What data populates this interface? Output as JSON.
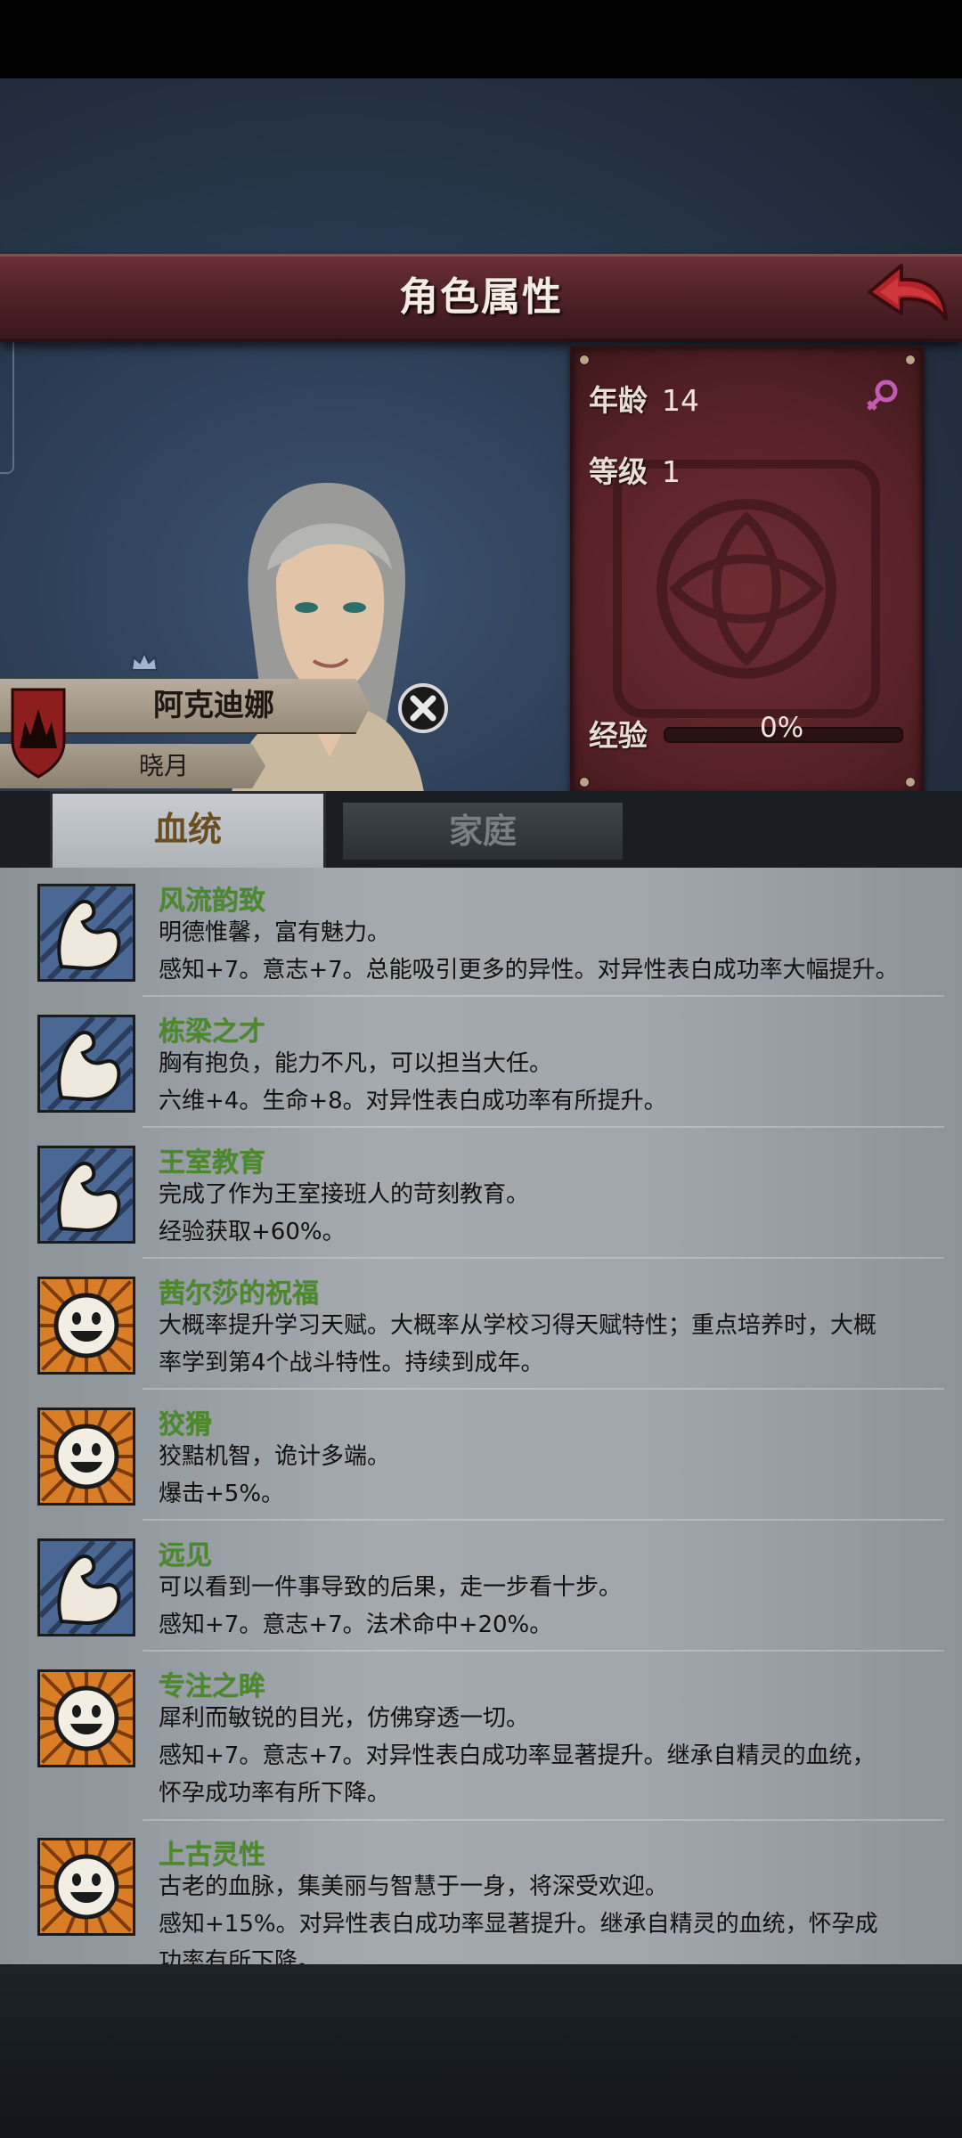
{
  "header": {
    "title": "角色属性"
  },
  "stats": {
    "age_label": "年龄",
    "age_value": "14",
    "level_label": "等级",
    "level_value": "1",
    "exp_label": "经验",
    "exp_value": "0%",
    "exp_fraction": 0
  },
  "character": {
    "name": "阿克迪娜",
    "house": "晓月"
  },
  "tabs": [
    {
      "label": "血统"
    },
    {
      "label": "家庭"
    }
  ],
  "traits": [
    {
      "name": "风流韵致",
      "icon": "muscle-icon",
      "lines": [
        "明德惟馨，富有魅力。",
        "感知+7。意志+7。总能吸引更多的异性。对异性表白成功率大幅提升。"
      ]
    },
    {
      "name": "栋梁之才",
      "icon": "muscle-icon",
      "lines": [
        "胸有抱负，能力不凡，可以担当大任。",
        "六维+4。生命+8。对异性表白成功率有所提升。"
      ]
    },
    {
      "name": "王室教育",
      "icon": "muscle-icon",
      "lines": [
        "完成了作为王室接班人的苛刻教育。",
        "经验获取+60%。"
      ]
    },
    {
      "name": "茜尔莎的祝福",
      "icon": "smiley-icon",
      "lines": [
        "大概率提升学习天赋。大概率从学校习得天赋特性；重点培养时，大概",
        "率学到第4个战斗特性。持续到成年。"
      ]
    },
    {
      "name": "狡猾",
      "icon": "smiley-icon",
      "lines": [
        "狡黠机智，诡计多端。",
        "爆击+5%。"
      ]
    },
    {
      "name": "远见",
      "icon": "muscle-icon",
      "lines": [
        "可以看到一件事导致的后果，走一步看十步。",
        "感知+7。意志+7。法术命中+20%。"
      ]
    },
    {
      "name": "专注之眸",
      "icon": "smiley-icon",
      "lines": [
        "犀利而敏锐的目光，仿佛穿透一切。",
        "感知+7。意志+7。对异性表白成功率显著提升。继承自精灵的血统，",
        "怀孕成功率有所下降。"
      ]
    },
    {
      "name": "上古灵性",
      "icon": "smiley-icon",
      "lines": [
        "古老的血脉，集美丽与智慧于一身，将深受欢迎。",
        "感知+15%。对异性表白成功率显著提升。继承自精灵的血统，怀孕成",
        "功率有所下降。"
      ]
    }
  ]
}
